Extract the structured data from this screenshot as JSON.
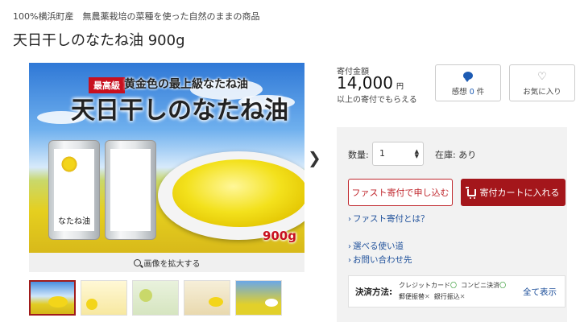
{
  "header": {
    "subtitle": "100%横浜町産　無農薬栽培の菜種を使った自然のままの商品",
    "title": "天日干しのなたね油 900g"
  },
  "gallery": {
    "image_badge": "最高級",
    "image_subtitle": "黄金色の最上級なたね油",
    "image_title": "天日干しのなたね油",
    "can_label": "なたね油",
    "weight_label": "900g",
    "zoom_label": "画像を拡大する",
    "next_icon": "chevron-right-icon",
    "active_thumbnail": 1
  },
  "price": {
    "label": "寄付金額",
    "amount": "14,000",
    "unit": "円",
    "note": "以上の寄付でもらえる"
  },
  "impressions": {
    "label": "感想",
    "count": "0",
    "suffix": "件"
  },
  "favorite": {
    "label": "お気に入り"
  },
  "purchase": {
    "qty_label": "数量:",
    "qty_value": "1",
    "stock_label": "在庫: あり",
    "fast_button": "ファスト寄付で申し込む",
    "cart_button": "寄付カートに入れる"
  },
  "links": {
    "fast_about": "ファスト寄付とは？",
    "usage": "選べる使い道",
    "contact": "お問い合わせ先"
  },
  "payment": {
    "label": "決済方法:",
    "methods": [
      {
        "name": "クレジットカード",
        "mark": "〇"
      },
      {
        "name": "コンビニ決済",
        "mark": "〇"
      },
      {
        "name": "郵便振替",
        "mark": "✕"
      },
      {
        "name": "銀行振込",
        "mark": "✕"
      }
    ],
    "show_all": "全て表示"
  },
  "colors": {
    "accent_red": "#a4161b",
    "link_blue": "#1d4f9a",
    "panel_gray": "#f2f2f2"
  }
}
